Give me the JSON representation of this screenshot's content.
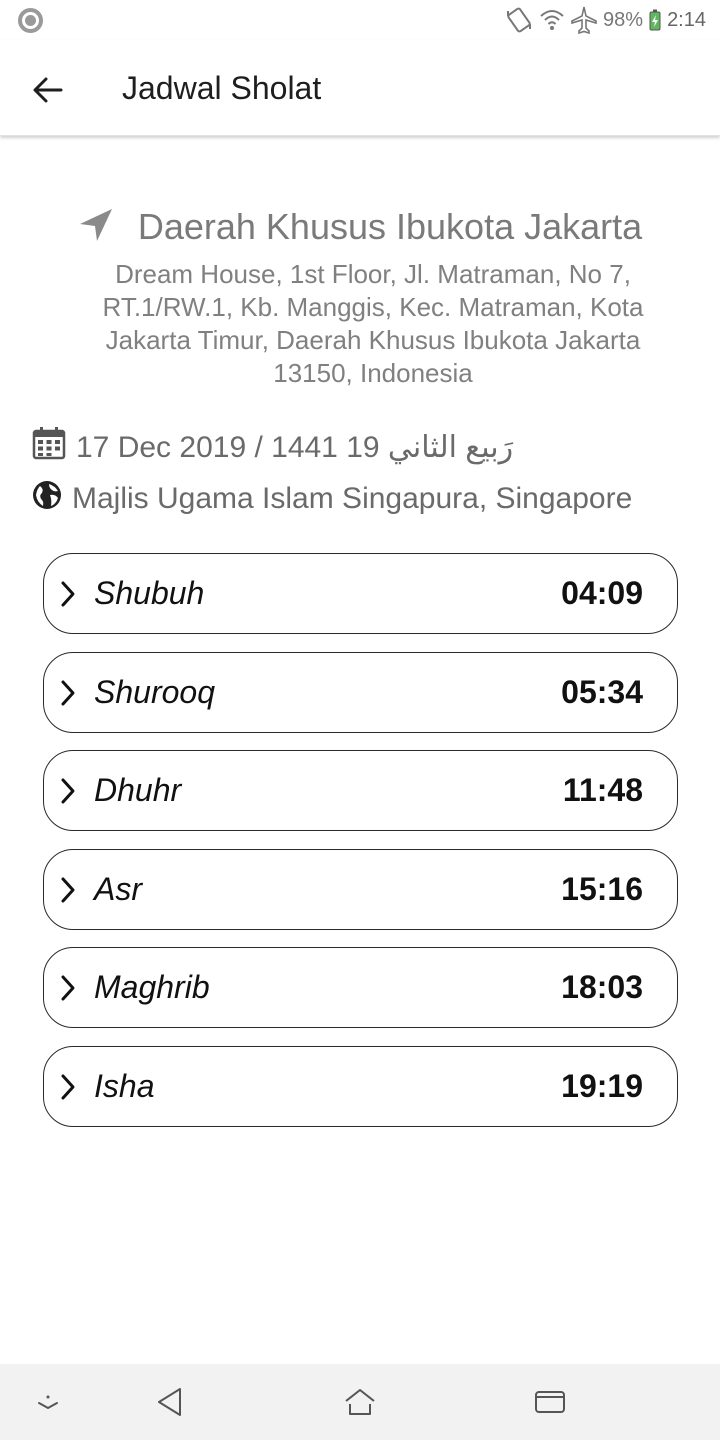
{
  "status_bar": {
    "battery": "98%",
    "time": "2:14",
    "icons": [
      "rotate-icon",
      "wifi-icon",
      "airplane-icon",
      "battery-charging-icon"
    ]
  },
  "app_bar": {
    "title": "Jadwal Sholat",
    "back_icon": "arrow-left-icon"
  },
  "location": {
    "name": "Daerah Khusus Ibukota Jakarta",
    "address": "Dream House, 1st Floor, Jl. Matraman, No 7, RT.1/RW.1, Kb. Manggis, Kec. Matraman, Kota Jakarta Timur, Daerah Khusus Ibukota Jakarta 13150, Indonesia",
    "icon": "navigation-arrow-icon"
  },
  "date": {
    "text": "17 Dec 2019 / 1441 رَبيع الثاني 19",
    "icon": "calendar-icon"
  },
  "source": {
    "text": "Majlis Ugama Islam Singapura, Singapore",
    "icon": "globe-icon"
  },
  "prayers": [
    {
      "name": "Shubuh",
      "time": "04:09"
    },
    {
      "name": "Shurooq",
      "time": "05:34"
    },
    {
      "name": "Dhuhr",
      "time": "11:48"
    },
    {
      "name": "Asr",
      "time": "15:16"
    },
    {
      "name": "Maghrib",
      "time": "18:03"
    },
    {
      "name": "Isha",
      "time": "19:19"
    }
  ],
  "nav_bar": {
    "icons": [
      "collapse-icon",
      "back-triangle-icon",
      "home-icon",
      "recents-icon"
    ]
  },
  "colors": {
    "text_primary": "#111111",
    "text_secondary": "#7a7a7a",
    "border": "#2a2a2a",
    "nav_background": "#f2f2f2"
  }
}
